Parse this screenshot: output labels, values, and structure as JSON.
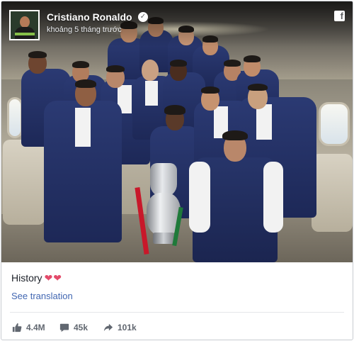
{
  "post": {
    "author": "Cristiano Ronaldo",
    "timestamp": "khoảng 5 tháng trước",
    "caption_text": "History",
    "caption_emoji": "❤❤",
    "see_translation_label": "See translation"
  },
  "stats": {
    "likes": "4.4M",
    "comments": "45k",
    "shares": "101k"
  },
  "icons": {
    "verified": "verified-check-icon",
    "platform": "facebook-icon",
    "like": "thumbs-up-icon",
    "comment": "comment-bubble-icon",
    "share": "share-arrow-icon"
  },
  "colors": {
    "link": "#4267b2",
    "text": "#1d2129",
    "muted": "#616770",
    "hearts": "#e34b6a"
  }
}
